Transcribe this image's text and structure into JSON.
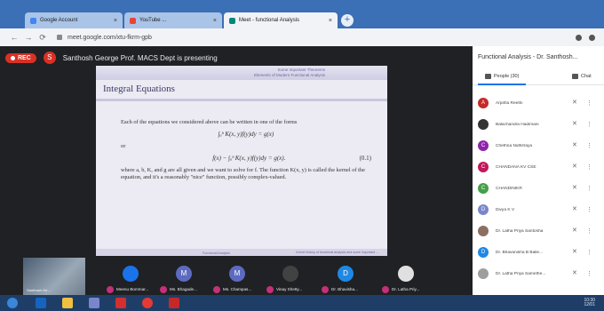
{
  "browser": {
    "tabs": [
      {
        "title": "Google Account",
        "fav_color": "#4285f4"
      },
      {
        "title": "YouTube ...",
        "fav_color": "#ea4335"
      },
      {
        "title": "Meet - functional Analysis",
        "fav_color": "#00897b"
      }
    ],
    "new_tab": "+",
    "url": "meet.google.com/xtu-fkrm-gpb",
    "nav": [
      "←",
      "→",
      "⟳"
    ]
  },
  "meeting": {
    "rec_label": "REC",
    "presenter_initial": "S",
    "presenting_text": "Santhosh George Prof. MACS Dept is presenting"
  },
  "slide": {
    "header_line1": "Some Important Theorems",
    "header_line2": "Elements of Modern Functional Analysis",
    "title": "Integral Equations",
    "intro": "Each of the equations we considered above can be written in one of the forms",
    "eq1": "∫ₐᵇ K(x, y)f(y)dy = g(x)",
    "or_text": "or",
    "eq2": "f(x) − ∫ₐᵇ K(x, y)f(y)dy = g(x).",
    "eq2_tag": "(0.1)",
    "body": "where a, b, K, and g are all given and we want to solve for f. The function K(x, y) is called the kernel of the equation, and it's a reasonably \"nice\" function, possibly complex-valued.",
    "footer": "A brief history of functional analysis and some important ...",
    "footer_left": "Functional Analysis"
  },
  "panel": {
    "title": "Functional Analysis - Dr. Santhosh...",
    "people_tab": "People (30)",
    "chat_tab": "Chat",
    "participants": [
      {
        "initial": "A",
        "name": "Arpitha Reethi",
        "color": "#c62828"
      },
      {
        "initial": "",
        "name": "Balachandra Hadimani",
        "color": "#333333"
      },
      {
        "initial": "C",
        "name": "Chethna Nidhifraya",
        "color": "#8e24aa"
      },
      {
        "initial": "C",
        "name": "CHANDANA KV CSE",
        "color": "#c2185b"
      },
      {
        "initial": "C",
        "name": "CHANDINIKR",
        "color": "#43a047"
      },
      {
        "initial": "D",
        "name": "Divya K V",
        "color": "#7986cb"
      },
      {
        "initial": "",
        "name": "Dr. Latha Priya Santosha",
        "color": "#8d6e63"
      },
      {
        "initial": "D",
        "name": "Dr. Bhavanisha B Balle...",
        "color": "#1e88e5"
      },
      {
        "initial": "",
        "name": "Dr. Latha Priya Samethe...",
        "color": "#9e9e9e"
      }
    ]
  },
  "tiles": {
    "self_label": "Santhosh Ge...",
    "items": [
      {
        "initial": "",
        "name": "Meenu Bommar...",
        "color": "#1a73e8"
      },
      {
        "initial": "M",
        "name": "Ms. Bhagade...",
        "color": "#5c6bc0"
      },
      {
        "initial": "M",
        "name": "Ms. Champas...",
        "color": "#5c6bc0"
      },
      {
        "initial": "",
        "name": "Vinay Shetty...",
        "color": "#424242"
      },
      {
        "initial": "D",
        "name": "Dr. Bhavisha...",
        "color": "#1e88e5"
      },
      {
        "initial": "",
        "name": "Dr. Latha Priy...",
        "color": "#e0e0e0"
      }
    ]
  },
  "taskbar": {
    "time": "10:30",
    "date": "12/01"
  }
}
